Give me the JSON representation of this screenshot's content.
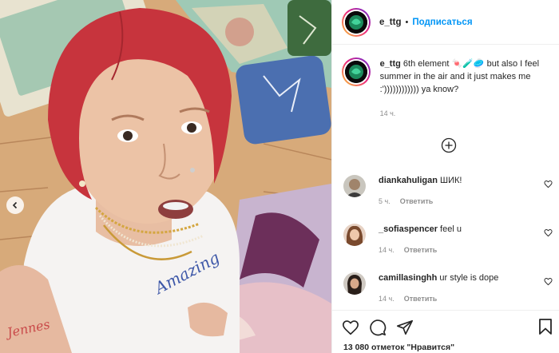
{
  "post": {
    "author": "e_ttg",
    "follow_label": "Подписаться",
    "separator": "•",
    "caption_text": "6th element 🍬🧪🥏 but also I feel summer in the air and it just makes me :')))))))))))) ya know?",
    "caption_time": "14 ч.",
    "likes_text": "13 080 отметок \"Нравится\""
  },
  "comments": [
    {
      "user": "diankahuligan",
      "text": "ШИК!",
      "time": "5 ч.",
      "reply_label": "Ответить"
    },
    {
      "user": "_sofiaspencer",
      "text": "feel u",
      "time": "14 ч.",
      "reply_label": "Ответить"
    },
    {
      "user": "camillasinghh",
      "text": "ur style is dope",
      "time": "14 ч.",
      "reply_label": "Ответить"
    }
  ],
  "photo": {
    "tattoo_text": "Jennes",
    "shirt_text": "Amazing"
  },
  "colors": {
    "follow": "#0095f6",
    "hair": "#c7343d",
    "ring_gradient": [
      "#f9ce34",
      "#ee2a7b",
      "#6228d7"
    ]
  },
  "icons": [
    "chevron-left-icon",
    "plus-circle-icon",
    "heart-icon",
    "comment-icon",
    "share-icon",
    "bookmark-icon"
  ]
}
